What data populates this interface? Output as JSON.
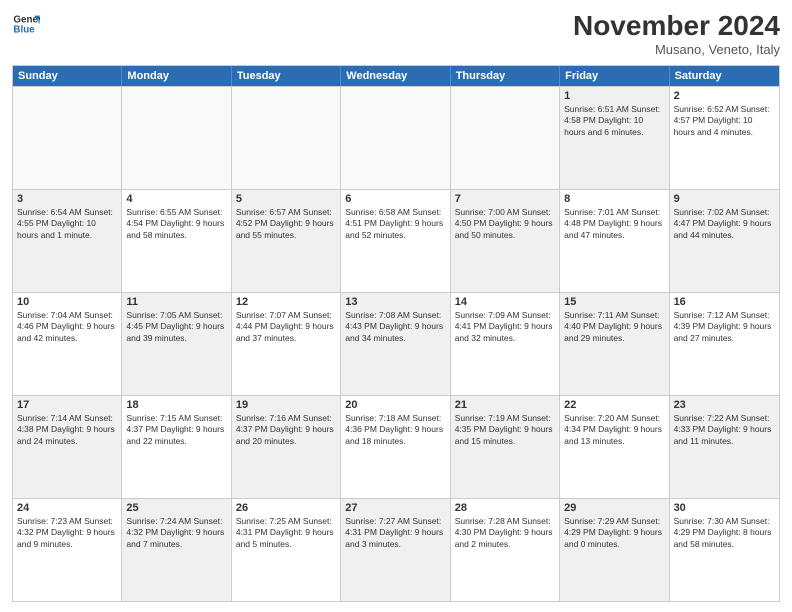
{
  "header": {
    "logo_general": "General",
    "logo_blue": "Blue",
    "month": "November 2024",
    "location": "Musano, Veneto, Italy"
  },
  "weekdays": [
    "Sunday",
    "Monday",
    "Tuesday",
    "Wednesday",
    "Thursday",
    "Friday",
    "Saturday"
  ],
  "rows": [
    [
      {
        "day": "",
        "info": "",
        "empty": true
      },
      {
        "day": "",
        "info": "",
        "empty": true
      },
      {
        "day": "",
        "info": "",
        "empty": true
      },
      {
        "day": "",
        "info": "",
        "empty": true
      },
      {
        "day": "",
        "info": "",
        "empty": true
      },
      {
        "day": "1",
        "info": "Sunrise: 6:51 AM\nSunset: 4:58 PM\nDaylight: 10 hours\nand 6 minutes.",
        "shaded": true
      },
      {
        "day": "2",
        "info": "Sunrise: 6:52 AM\nSunset: 4:57 PM\nDaylight: 10 hours\nand 4 minutes.",
        "shaded": false
      }
    ],
    [
      {
        "day": "3",
        "info": "Sunrise: 6:54 AM\nSunset: 4:55 PM\nDaylight: 10 hours\nand 1 minute.",
        "shaded": true
      },
      {
        "day": "4",
        "info": "Sunrise: 6:55 AM\nSunset: 4:54 PM\nDaylight: 9 hours\nand 58 minutes.",
        "shaded": false
      },
      {
        "day": "5",
        "info": "Sunrise: 6:57 AM\nSunset: 4:52 PM\nDaylight: 9 hours\nand 55 minutes.",
        "shaded": true
      },
      {
        "day": "6",
        "info": "Sunrise: 6:58 AM\nSunset: 4:51 PM\nDaylight: 9 hours\nand 52 minutes.",
        "shaded": false
      },
      {
        "day": "7",
        "info": "Sunrise: 7:00 AM\nSunset: 4:50 PM\nDaylight: 9 hours\nand 50 minutes.",
        "shaded": true
      },
      {
        "day": "8",
        "info": "Sunrise: 7:01 AM\nSunset: 4:48 PM\nDaylight: 9 hours\nand 47 minutes.",
        "shaded": false
      },
      {
        "day": "9",
        "info": "Sunrise: 7:02 AM\nSunset: 4:47 PM\nDaylight: 9 hours\nand 44 minutes.",
        "shaded": true
      }
    ],
    [
      {
        "day": "10",
        "info": "Sunrise: 7:04 AM\nSunset: 4:46 PM\nDaylight: 9 hours\nand 42 minutes.",
        "shaded": false
      },
      {
        "day": "11",
        "info": "Sunrise: 7:05 AM\nSunset: 4:45 PM\nDaylight: 9 hours\nand 39 minutes.",
        "shaded": true
      },
      {
        "day": "12",
        "info": "Sunrise: 7:07 AM\nSunset: 4:44 PM\nDaylight: 9 hours\nand 37 minutes.",
        "shaded": false
      },
      {
        "day": "13",
        "info": "Sunrise: 7:08 AM\nSunset: 4:43 PM\nDaylight: 9 hours\nand 34 minutes.",
        "shaded": true
      },
      {
        "day": "14",
        "info": "Sunrise: 7:09 AM\nSunset: 4:41 PM\nDaylight: 9 hours\nand 32 minutes.",
        "shaded": false
      },
      {
        "day": "15",
        "info": "Sunrise: 7:11 AM\nSunset: 4:40 PM\nDaylight: 9 hours\nand 29 minutes.",
        "shaded": true
      },
      {
        "day": "16",
        "info": "Sunrise: 7:12 AM\nSunset: 4:39 PM\nDaylight: 9 hours\nand 27 minutes.",
        "shaded": false
      }
    ],
    [
      {
        "day": "17",
        "info": "Sunrise: 7:14 AM\nSunset: 4:38 PM\nDaylight: 9 hours\nand 24 minutes.",
        "shaded": true
      },
      {
        "day": "18",
        "info": "Sunrise: 7:15 AM\nSunset: 4:37 PM\nDaylight: 9 hours\nand 22 minutes.",
        "shaded": false
      },
      {
        "day": "19",
        "info": "Sunrise: 7:16 AM\nSunset: 4:37 PM\nDaylight: 9 hours\nand 20 minutes.",
        "shaded": true
      },
      {
        "day": "20",
        "info": "Sunrise: 7:18 AM\nSunset: 4:36 PM\nDaylight: 9 hours\nand 18 minutes.",
        "shaded": false
      },
      {
        "day": "21",
        "info": "Sunrise: 7:19 AM\nSunset: 4:35 PM\nDaylight: 9 hours\nand 15 minutes.",
        "shaded": true
      },
      {
        "day": "22",
        "info": "Sunrise: 7:20 AM\nSunset: 4:34 PM\nDaylight: 9 hours\nand 13 minutes.",
        "shaded": false
      },
      {
        "day": "23",
        "info": "Sunrise: 7:22 AM\nSunset: 4:33 PM\nDaylight: 9 hours\nand 11 minutes.",
        "shaded": true
      }
    ],
    [
      {
        "day": "24",
        "info": "Sunrise: 7:23 AM\nSunset: 4:32 PM\nDaylight: 9 hours\nand 9 minutes.",
        "shaded": false
      },
      {
        "day": "25",
        "info": "Sunrise: 7:24 AM\nSunset: 4:32 PM\nDaylight: 9 hours\nand 7 minutes.",
        "shaded": true
      },
      {
        "day": "26",
        "info": "Sunrise: 7:25 AM\nSunset: 4:31 PM\nDaylight: 9 hours\nand 5 minutes.",
        "shaded": false
      },
      {
        "day": "27",
        "info": "Sunrise: 7:27 AM\nSunset: 4:31 PM\nDaylight: 9 hours\nand 3 minutes.",
        "shaded": true
      },
      {
        "day": "28",
        "info": "Sunrise: 7:28 AM\nSunset: 4:30 PM\nDaylight: 9 hours\nand 2 minutes.",
        "shaded": false
      },
      {
        "day": "29",
        "info": "Sunrise: 7:29 AM\nSunset: 4:29 PM\nDaylight: 9 hours\nand 0 minutes.",
        "shaded": true
      },
      {
        "day": "30",
        "info": "Sunrise: 7:30 AM\nSunset: 4:29 PM\nDaylight: 8 hours\nand 58 minutes.",
        "shaded": false
      }
    ]
  ]
}
